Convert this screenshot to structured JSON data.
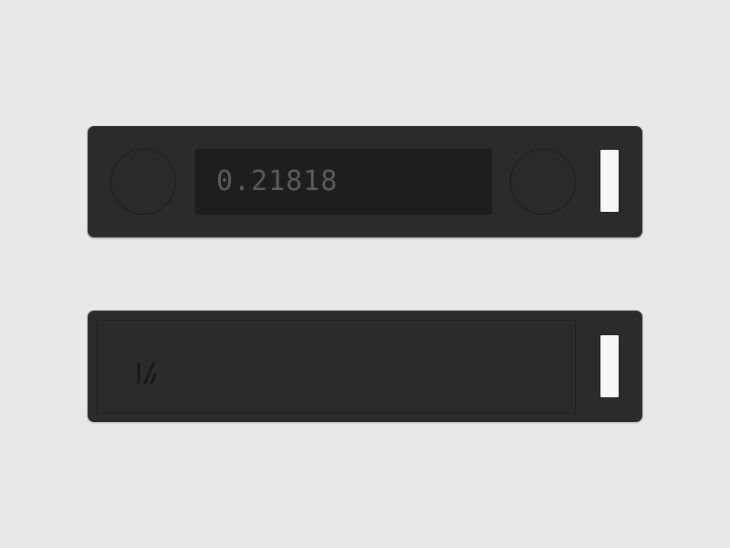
{
  "scene": {
    "background_color": "#e8e8e8",
    "device_color": "#2b2b2b",
    "screen_color": "#1e1e1e",
    "slot_color": "#f7f7f7"
  },
  "front": {
    "screen": {
      "value": "0.21818",
      "text_color": "#5c5c5c"
    },
    "left_button_icon": "circle-button-icon",
    "right_button_icon": "circle-button-icon"
  },
  "back": {
    "logo_icon": "brand-logo-icon"
  }
}
